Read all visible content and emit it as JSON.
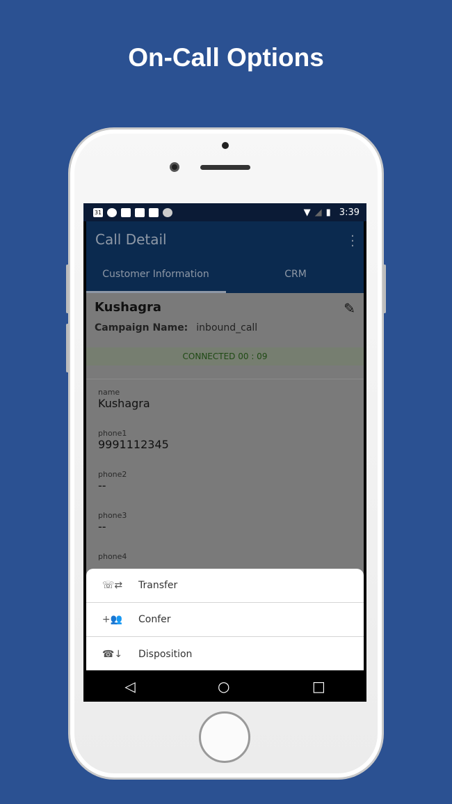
{
  "headline": "On-Call Options",
  "status_bar": {
    "time": "3:39",
    "calendar_day": "31"
  },
  "app_bar": {
    "title": "Call Detail"
  },
  "tabs": [
    {
      "label": "Customer Information",
      "active": true
    },
    {
      "label": "CRM",
      "active": false
    }
  ],
  "customer": {
    "name": "Kushagra",
    "campaign_label": "Campaign Name:",
    "campaign_value": "inbound_call",
    "call_status": "CONNECTED 00 : 09"
  },
  "fields": [
    {
      "label": "name",
      "value": "Kushagra"
    },
    {
      "label": "phone1",
      "value": "9991112345"
    },
    {
      "label": "phone2",
      "value": "--"
    },
    {
      "label": "phone3",
      "value": "--"
    },
    {
      "label": "phone4",
      "value": ""
    }
  ],
  "sheet": {
    "items": [
      {
        "label": "Transfer",
        "icon": "phone-transfer-icon"
      },
      {
        "label": "Confer",
        "icon": "add-group-icon"
      },
      {
        "label": "Disposition",
        "icon": "hang-up-icon"
      }
    ]
  },
  "colors": {
    "background": "#2b5192",
    "app_bar": "#0b2a4f",
    "connected_text": "#1f4a14"
  }
}
